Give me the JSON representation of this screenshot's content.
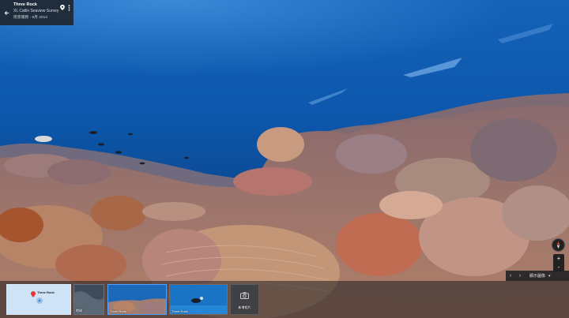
{
  "info_card": {
    "title": "Three Rock",
    "subtitle": "XL Catlin Seaview Survey",
    "meta": "街景服務 - 9月 2014",
    "icons": [
      "back-arrow-icon",
      "location-pin-icon",
      "more-vert-icon"
    ]
  },
  "nav_strip": {
    "label": "顯示圖像",
    "prev_icon": "chevron-left-icon",
    "next_icon": "chevron-right-icon",
    "collapse_icon": "chevron-down-icon"
  },
  "thumbnails": [
    {
      "kind": "map",
      "label": "Three Rock"
    },
    {
      "kind": "satellite",
      "label": "地球"
    },
    {
      "kind": "panorama",
      "label": "Three Rock",
      "selected": true
    },
    {
      "kind": "panorama",
      "label": "Three Rock",
      "selected": false
    },
    {
      "kind": "add-photo",
      "label": "新增相片"
    }
  ],
  "controls": {
    "compass_icon": "compass-icon",
    "zoom_in": "+",
    "zoom_out": "-"
  },
  "colors": {
    "card_bg": "#1e2228",
    "accent": "#4ea1ff",
    "water_top": "#0e4f9e",
    "water_deep": "#0a3a73"
  }
}
